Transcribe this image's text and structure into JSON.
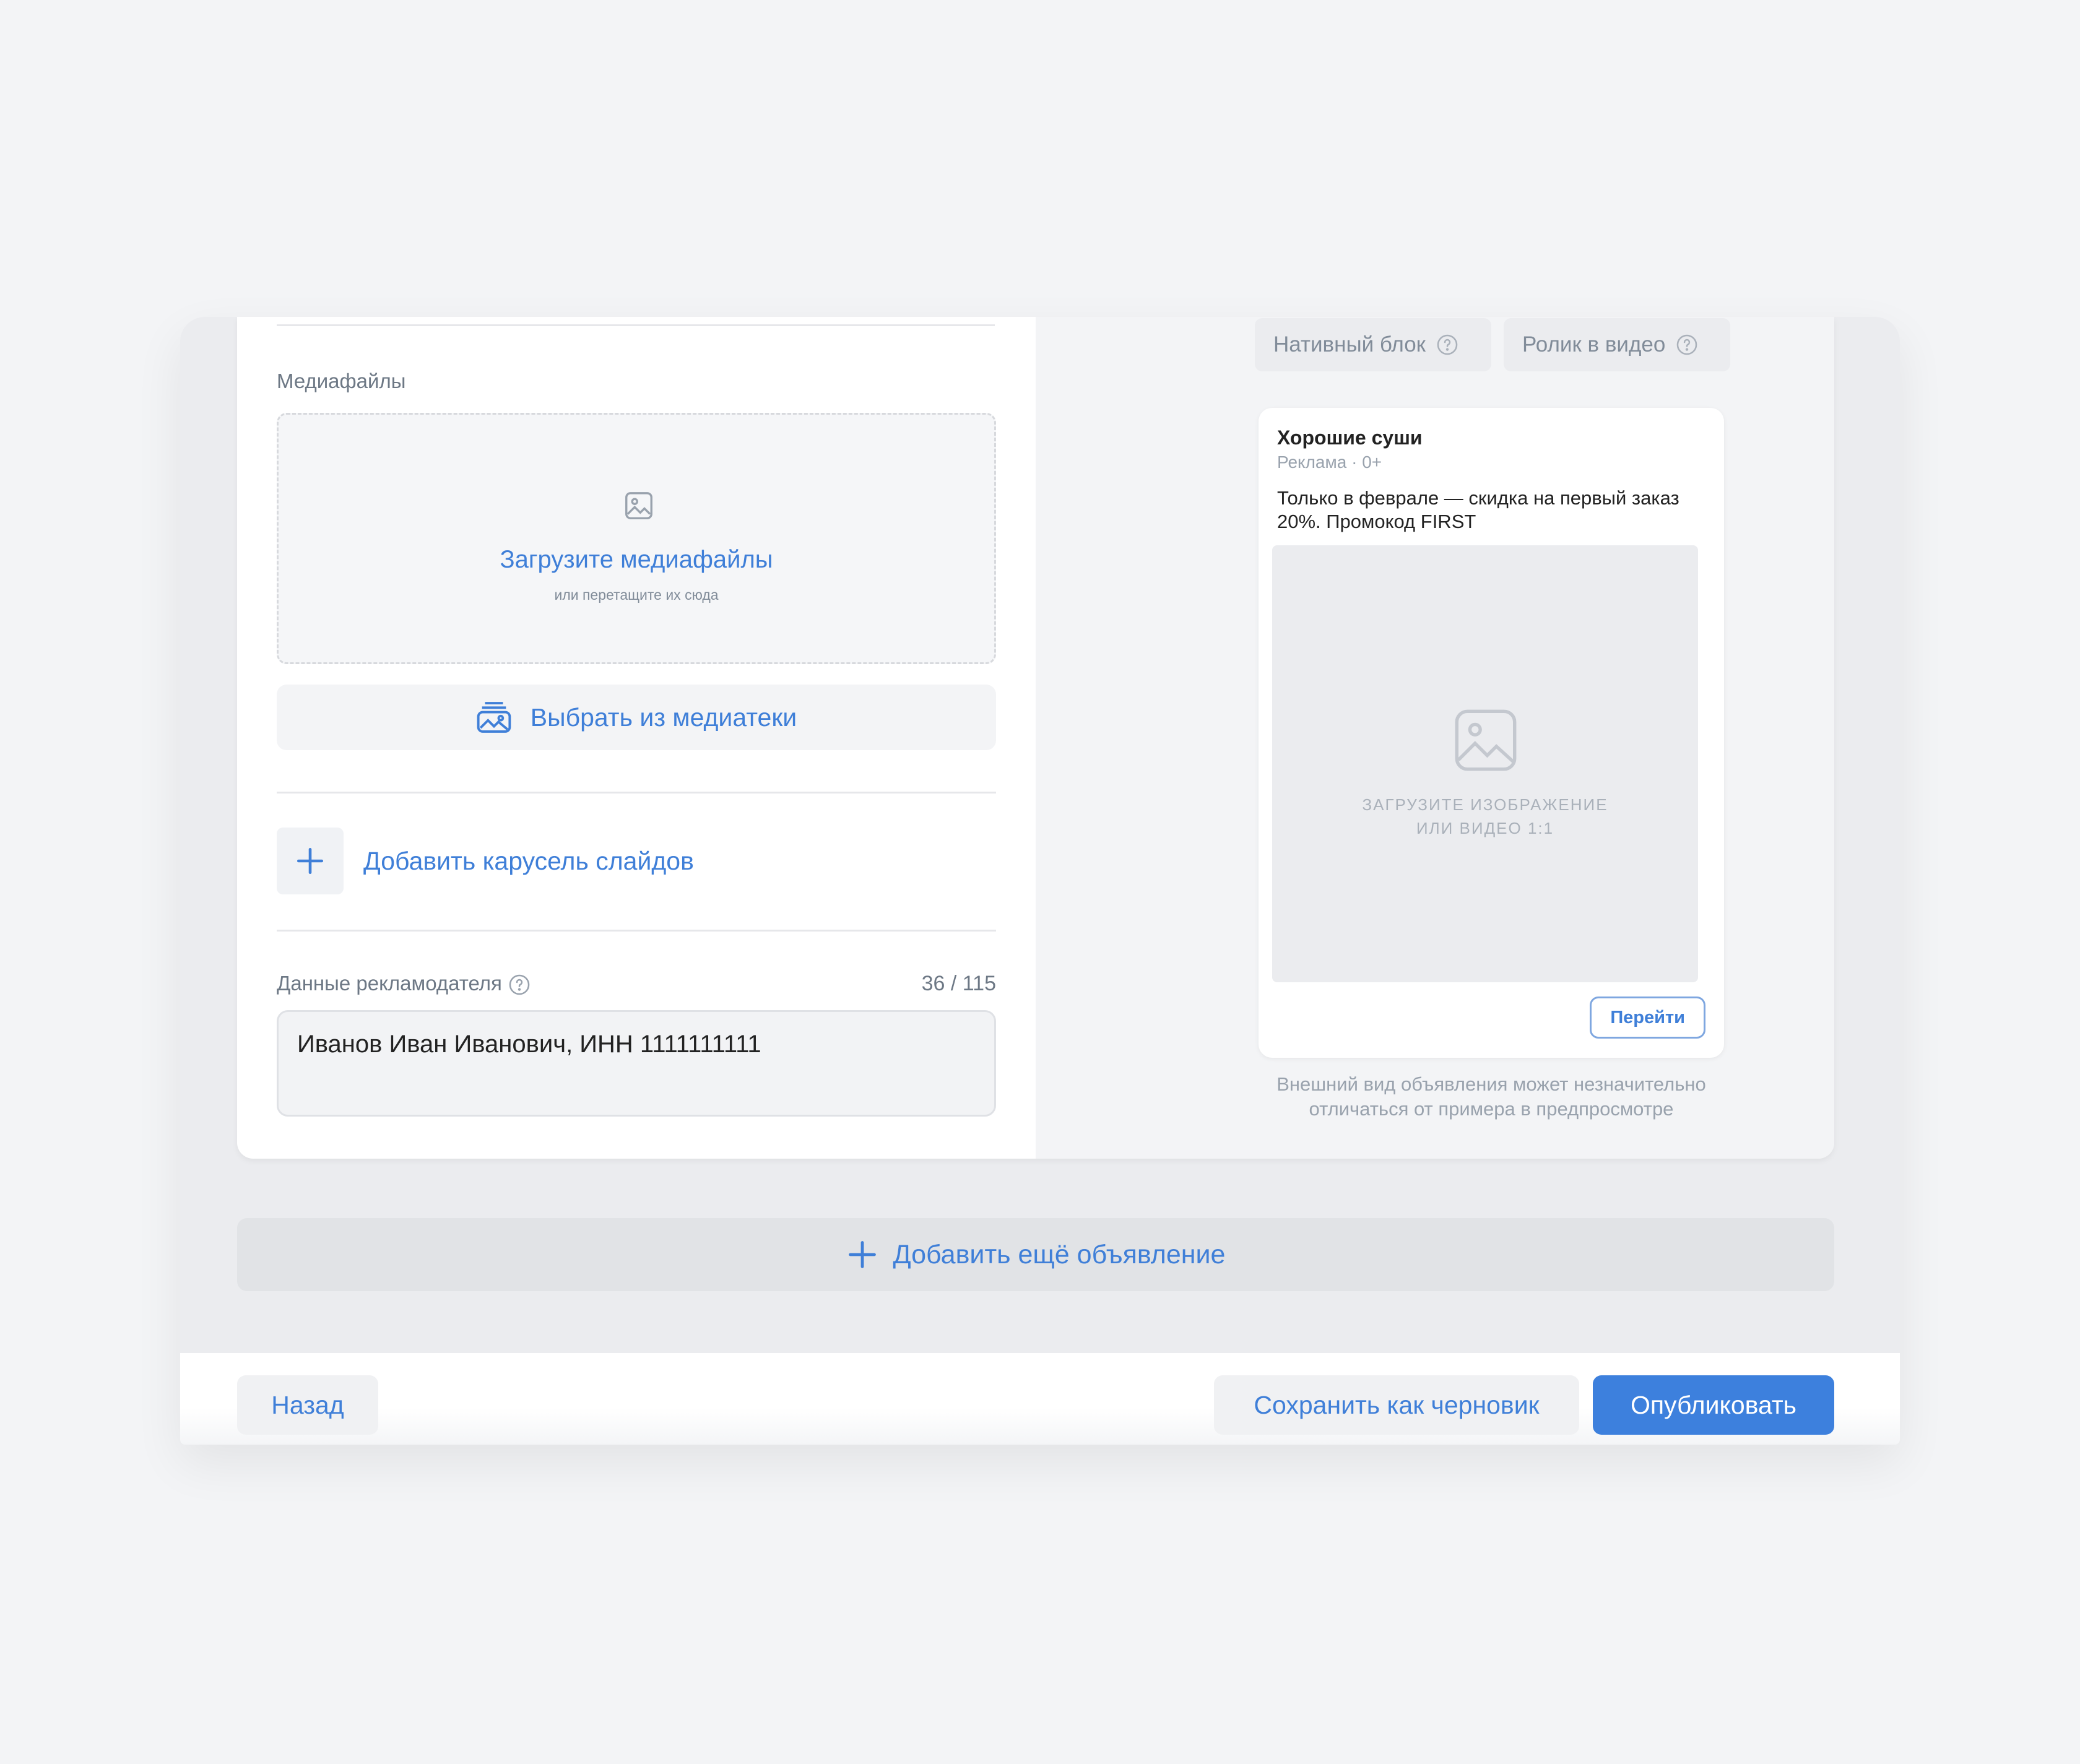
{
  "form": {
    "media_label": "Медиафайлы",
    "upload_title": "Загрузите медиафайлы",
    "upload_subtitle": "или перетащите их сюда",
    "library_button": "Выбрать из медиатеки",
    "carousel_button": "Добавить карусель слайдов",
    "advertiser_label": "Данные рекламодателя",
    "advertiser_counter": "36 / 115",
    "advertiser_value": "Иванов Иван Иванович, ИНН 1111111111"
  },
  "preview": {
    "tabs": [
      {
        "label": "Нативный блок"
      },
      {
        "label": "Ролик в видео"
      }
    ],
    "ad": {
      "title": "Хорошие суши",
      "meta": "Реклама · 0+",
      "text": "Только в феврале — скидка на первый заказ 20%. Промокод FIRST",
      "image_caption_line1": "ЗАГРУЗИТЕ ИЗОБРАЖЕНИЕ",
      "image_caption_line2": "ИЛИ ВИДЕО 1:1",
      "button": "Перейти"
    },
    "note": "Внешний вид объявления может незначительно отличаться от примера в предпросмотре"
  },
  "add_ad_button": "Добавить ещё объявление",
  "footer": {
    "back": "Назад",
    "save_draft": "Сохранить как черновик",
    "publish": "Опубликовать"
  },
  "icons": {
    "upload": "image-icon",
    "library": "gallery-icon",
    "carousel": "plus-icon",
    "help": "question-circle-icon"
  },
  "colors": {
    "accent": "#3f7fd8",
    "primary_button": "#3d80dd",
    "background": "#f3f4f6"
  }
}
